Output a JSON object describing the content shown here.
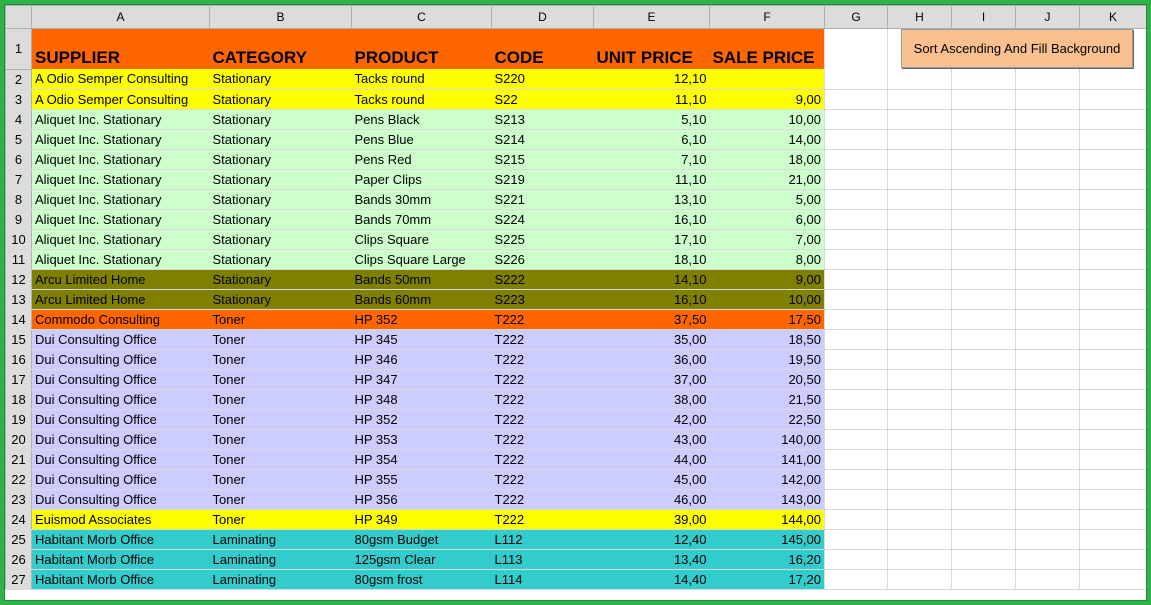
{
  "columns": [
    "A",
    "B",
    "C",
    "D",
    "E",
    "F",
    "G",
    "H",
    "I",
    "J",
    "K"
  ],
  "header": {
    "row_num": "1",
    "supplier": "SUPPLIER",
    "category": "CATEGORY",
    "product": "PRODUCT",
    "code": "CODE",
    "unit_price": "UNIT PRICE",
    "sale_price": "SALE PRICE",
    "color": "#ff6600"
  },
  "sort_button": {
    "label": "Sort Ascending And Fill Background",
    "color": "#fac08f"
  },
  "row_colors": {
    "yellow": "#ffff00",
    "green": "#ccffcc",
    "olive": "#808000",
    "orange": "#ff6600",
    "lavender": "#ccccff",
    "teal": "#33cccc"
  },
  "rows": [
    {
      "num": "2",
      "supplier": "A Odio Semper Consulting",
      "category": "Stationary",
      "product": "Tacks round",
      "code": "S220",
      "unit": "12,10",
      "sale": "",
      "color": "yellow"
    },
    {
      "num": "3",
      "supplier": "A Odio Semper Consulting",
      "category": "Stationary",
      "product": "Tacks round",
      "code": "S22",
      "unit": "11,10",
      "sale": "9,00",
      "color": "yellow"
    },
    {
      "num": "4",
      "supplier": "Aliquet Inc. Stationary",
      "category": "Stationary",
      "product": "Pens Black",
      "code": "S213",
      "unit": "5,10",
      "sale": "10,00",
      "color": "green"
    },
    {
      "num": "5",
      "supplier": "Aliquet Inc. Stationary",
      "category": "Stationary",
      "product": "Pens Blue",
      "code": "S214",
      "unit": "6,10",
      "sale": "14,00",
      "color": "green"
    },
    {
      "num": "6",
      "supplier": "Aliquet Inc. Stationary",
      "category": "Stationary",
      "product": "Pens Red",
      "code": "S215",
      "unit": "7,10",
      "sale": "18,00",
      "color": "green"
    },
    {
      "num": "7",
      "supplier": "Aliquet Inc. Stationary",
      "category": "Stationary",
      "product": "Paper Clips",
      "code": "S219",
      "unit": "11,10",
      "sale": "21,00",
      "color": "green"
    },
    {
      "num": "8",
      "supplier": "Aliquet Inc. Stationary",
      "category": "Stationary",
      "product": "Bands 30mm",
      "code": "S221",
      "unit": "13,10",
      "sale": "5,00",
      "color": "green"
    },
    {
      "num": "9",
      "supplier": "Aliquet Inc. Stationary",
      "category": "Stationary",
      "product": "Bands 70mm",
      "code": "S224",
      "unit": "16,10",
      "sale": "6,00",
      "color": "green"
    },
    {
      "num": "10",
      "supplier": "Aliquet Inc. Stationary",
      "category": "Stationary",
      "product": "Clips Square",
      "code": "S225",
      "unit": "17,10",
      "sale": "7,00",
      "color": "green"
    },
    {
      "num": "11",
      "supplier": "Aliquet Inc. Stationary",
      "category": "Stationary",
      "product": "Clips Square Large",
      "code": "S226",
      "unit": "18,10",
      "sale": "8,00",
      "color": "green"
    },
    {
      "num": "12",
      "supplier": "Arcu Limited Home",
      "category": "Stationary",
      "product": "Bands 50mm",
      "code": "S222",
      "unit": "14,10",
      "sale": "9,00",
      "color": "olive"
    },
    {
      "num": "13",
      "supplier": "Arcu Limited Home",
      "category": "Stationary",
      "product": "Bands 60mm",
      "code": "S223",
      "unit": "16,10",
      "sale": "10,00",
      "color": "olive"
    },
    {
      "num": "14",
      "supplier": "Commodo Consulting",
      "category": "Toner",
      "product": "HP 352",
      "code": "T222",
      "unit": "37,50",
      "sale": "17,50",
      "color": "orange"
    },
    {
      "num": "15",
      "supplier": "Dui Consulting Office",
      "category": "Toner",
      "product": "HP 345",
      "code": "T222",
      "unit": "35,00",
      "sale": "18,50",
      "color": "lavender"
    },
    {
      "num": "16",
      "supplier": "Dui Consulting Office",
      "category": "Toner",
      "product": "HP 346",
      "code": "T222",
      "unit": "36,00",
      "sale": "19,50",
      "color": "lavender"
    },
    {
      "num": "17",
      "supplier": "Dui Consulting Office",
      "category": "Toner",
      "product": "HP 347",
      "code": "T222",
      "unit": "37,00",
      "sale": "20,50",
      "color": "lavender"
    },
    {
      "num": "18",
      "supplier": "Dui Consulting Office",
      "category": "Toner",
      "product": "HP 348",
      "code": "T222",
      "unit": "38,00",
      "sale": "21,50",
      "color": "lavender"
    },
    {
      "num": "19",
      "supplier": "Dui Consulting Office",
      "category": "Toner",
      "product": "HP 352",
      "code": "T222",
      "unit": "42,00",
      "sale": "22,50",
      "color": "lavender"
    },
    {
      "num": "20",
      "supplier": "Dui Consulting Office",
      "category": "Toner",
      "product": "HP 353",
      "code": "T222",
      "unit": "43,00",
      "sale": "140,00",
      "color": "lavender"
    },
    {
      "num": "21",
      "supplier": "Dui Consulting Office",
      "category": "Toner",
      "product": "HP 354",
      "code": "T222",
      "unit": "44,00",
      "sale": "141,00",
      "color": "lavender"
    },
    {
      "num": "22",
      "supplier": "Dui Consulting Office",
      "category": "Toner",
      "product": "HP 355",
      "code": "T222",
      "unit": "45,00",
      "sale": "142,00",
      "color": "lavender"
    },
    {
      "num": "23",
      "supplier": "Dui Consulting Office",
      "category": "Toner",
      "product": "HP 356",
      "code": "T222",
      "unit": "46,00",
      "sale": "143,00",
      "color": "lavender"
    },
    {
      "num": "24",
      "supplier": "Euismod Associates",
      "category": "Toner",
      "product": "HP 349",
      "code": "T222",
      "unit": "39,00",
      "sale": "144,00",
      "color": "yellow"
    },
    {
      "num": "25",
      "supplier": "Habitant Morb Office",
      "category": "Laminating",
      "product": "80gsm Budget",
      "code": "L112",
      "unit": "12,40",
      "sale": "145,00",
      "color": "teal"
    },
    {
      "num": "26",
      "supplier": "Habitant Morb Office",
      "category": "Laminating",
      "product": "125gsm Clear",
      "code": "L113",
      "unit": "13,40",
      "sale": "16,20",
      "color": "teal"
    },
    {
      "num": "27",
      "supplier": "Habitant Morb Office",
      "category": "Laminating",
      "product": "80gsm frost",
      "code": "L114",
      "unit": "14,40",
      "sale": "17,20",
      "color": "teal"
    }
  ]
}
